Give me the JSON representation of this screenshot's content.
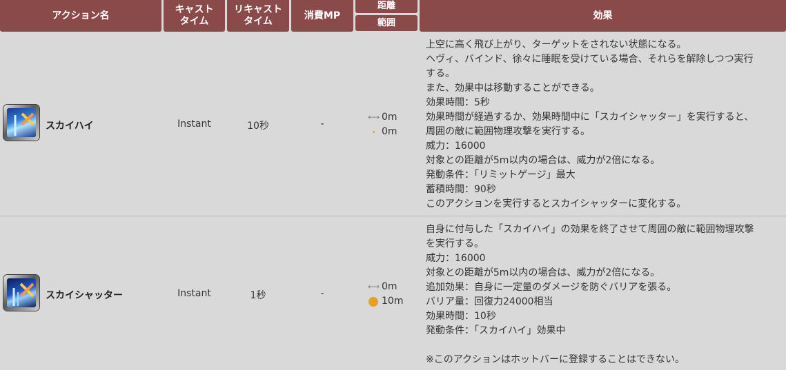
{
  "header": {
    "action_name": "アクション名",
    "cast_time": "キャスト\nタイム",
    "recast_time": "リキャスト\nタイム",
    "mp": "消費MP",
    "distance": "距離",
    "range": "範囲",
    "effect": "効果"
  },
  "rows": [
    {
      "name": "スカイハイ",
      "cast": "Instant",
      "recast": "10秒",
      "mp": "-",
      "distance": "0m",
      "range": "0m",
      "effect": [
        "上空に高く飛び上がり、ターゲットをされない状態になる。",
        "ヘヴィ、バインド、徐々に睡眠を受けている場合、それらを解除しつつ実行",
        "する。",
        "また、効果中は移動することができる。",
        "効果時間：5秒",
        "効果時間が経過するか、効果時間中に「スカイシャッター」を実行すると、",
        "周囲の敵に範囲物理攻撃を実行する。",
        "威力：16000",
        "対象との距離が5m以内の場合は、威力が2倍になる。",
        "発動条件：「リミットゲージ」最大",
        "蓄積時間：90秒",
        "このアクションを実行するとスカイシャッターに変化する。"
      ]
    },
    {
      "name": "スカイシャッター",
      "cast": "Instant",
      "recast": "1秒",
      "mp": "-",
      "distance": "0m",
      "range": "10m",
      "effect": [
        "自身に付与した「スカイハイ」の効果を終了させて周囲の敵に範囲物理攻撃",
        "を実行する。",
        "威力：16000",
        "対象との距離が5m以内の場合は、威力が2倍になる。",
        "追加効果：自身に一定量のダメージを防ぐバリアを張る。",
        "バリア量：回復力24000相当",
        "効果時間：10秒",
        "発動条件：「スカイハイ」効果中",
        "",
        "※このアクションはホットバーに登録することはできない。"
      ]
    }
  ],
  "colors": {
    "header_bg": "#8b4a4a",
    "row_bg": "#d9d9d9",
    "range_dot": "#e8a020"
  },
  "icons": [
    "skyhigh-skill-icon",
    "skyshatter-skill-icon",
    "distance-arrow-icon",
    "range-dot-icon"
  ]
}
